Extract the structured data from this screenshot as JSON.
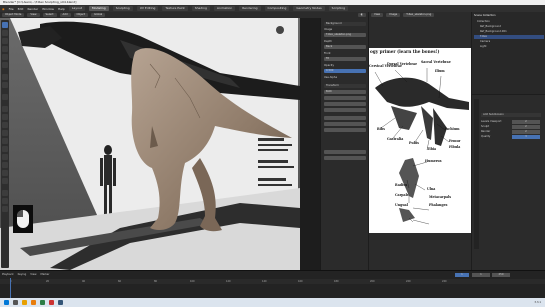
{
  "window": {
    "title": "Blender* [C:\\Users\\...\\T-Rex Sculpting_v04.blend]"
  },
  "menu": {
    "items": [
      "File",
      "Edit",
      "Render",
      "Window",
      "Help"
    ],
    "workspaces": [
      "Layout",
      "Modeling",
      "Sculpting",
      "UV Editing",
      "Texture Paint",
      "Shading",
      "Animation",
      "Rendering",
      "Compositing",
      "Geometry Nodes",
      "Scripting"
    ],
    "active_workspace": "Modeling"
  },
  "viewport_header": {
    "mode": "Object Mode",
    "buttons": [
      "View",
      "Select",
      "Add",
      "Object"
    ],
    "transform": "Global"
  },
  "npanel": {
    "sections": [
      "Background",
      "Image",
      "Depth",
      "Front",
      "Opacity",
      "Use Alpha",
      "Transform"
    ],
    "values": {
      "depth": "Back",
      "opacity": "0.500",
      "frame_method": "Fit",
      "side": "Both"
    }
  },
  "reference_panel": {
    "header_buttons": [
      "View",
      "Image"
    ],
    "image_name": "T-Rex_skeleton.png",
    "heading": "ogy primer (learn the bones!)",
    "labels": [
      "Dorsal Vertebrae",
      "Sacral Vertebrae",
      "Cervical Vertebrae",
      "Ilium",
      "Ribs",
      "Gastralia",
      "Pubis",
      "Ischium",
      "Femur",
      "Fibula",
      "Tibia",
      "Humerus",
      "Radius",
      "Ulna",
      "Carpals",
      "Metacarpals",
      "Phalanges",
      "Ungual"
    ]
  },
  "outliner": {
    "title": "Scene Collection",
    "items": [
      "Collection",
      "Ref_Background",
      "Ref_Background.001",
      "T-Rex",
      "Camera",
      "Light"
    ]
  },
  "properties": {
    "section": "Add Subdivision",
    "fields": [
      {
        "label": "Levels Viewport",
        "value": "2"
      },
      {
        "label": "Sculpt",
        "value": "2"
      },
      {
        "label": "Render",
        "value": "2"
      },
      {
        "label": "Quality",
        "value": "3"
      }
    ]
  },
  "timeline": {
    "menu": [
      "Playback",
      "Keying",
      "View",
      "Marker"
    ],
    "current_frame": "1",
    "start": "1",
    "end": "250",
    "ticks": [
      "0",
      "20",
      "40",
      "60",
      "80",
      "100",
      "120",
      "140",
      "160",
      "180",
      "200",
      "220",
      "240"
    ]
  },
  "statusbar": {
    "version": "3.3.1"
  },
  "colors": {
    "accent": "#4772b3",
    "viewport_bg": "#585858",
    "panel_bg": "#2b2b2b"
  }
}
